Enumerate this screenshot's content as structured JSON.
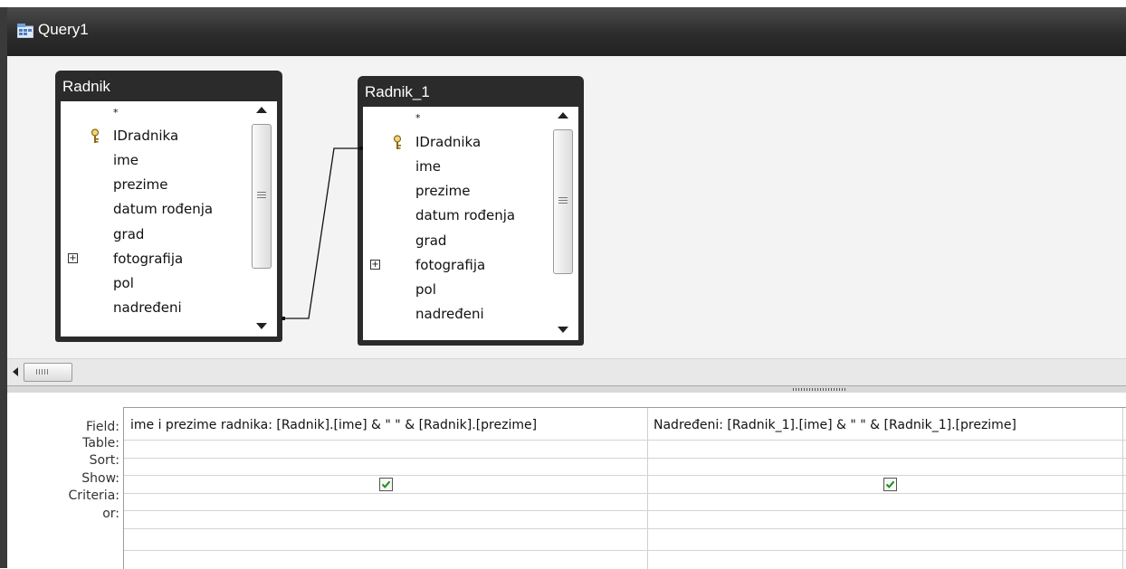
{
  "window": {
    "title": "Query1",
    "icon": "query-icon"
  },
  "tables": [
    {
      "name": "Radnik",
      "fields": [
        {
          "label": "*",
          "key": false,
          "expandable": false
        },
        {
          "label": "IDradnika",
          "key": true,
          "expandable": false
        },
        {
          "label": "ime",
          "key": false,
          "expandable": false
        },
        {
          "label": "prezime",
          "key": false,
          "expandable": false
        },
        {
          "label": "datum rođenja",
          "key": false,
          "expandable": false
        },
        {
          "label": "grad",
          "key": false,
          "expandable": false
        },
        {
          "label": "fotografija",
          "key": false,
          "expandable": true
        },
        {
          "label": "pol",
          "key": false,
          "expandable": false
        },
        {
          "label": "nadređeni",
          "key": false,
          "expandable": false
        }
      ]
    },
    {
      "name": "Radnik_1",
      "fields": [
        {
          "label": "*",
          "key": false,
          "expandable": false
        },
        {
          "label": "IDradnika",
          "key": true,
          "expandable": false
        },
        {
          "label": "ime",
          "key": false,
          "expandable": false
        },
        {
          "label": "prezime",
          "key": false,
          "expandable": false
        },
        {
          "label": "datum rođenja",
          "key": false,
          "expandable": false
        },
        {
          "label": "grad",
          "key": false,
          "expandable": false
        },
        {
          "label": "fotografija",
          "key": false,
          "expandable": true
        },
        {
          "label": "pol",
          "key": false,
          "expandable": false
        },
        {
          "label": "nadređeni",
          "key": false,
          "expandable": false
        }
      ]
    }
  ],
  "join": {
    "from": "Radnik.nadređeni",
    "to": "Radnik_1.IDradnika"
  },
  "grid": {
    "row_labels": [
      "Field:",
      "Table:",
      "Sort:",
      "Show:",
      "Criteria:",
      "or:"
    ],
    "columns": [
      {
        "field": "ime i prezime radnika: [Radnik].[ime] & \" \" & [Radnik].[prezime]",
        "table": "",
        "sort": "",
        "show": true,
        "criteria": "",
        "or": ""
      },
      {
        "field": "Nadređeni: [Radnik_1].[ime] & \" \" & [Radnik_1].[prezime]",
        "table": "",
        "sort": "",
        "show": true,
        "criteria": "",
        "or": ""
      }
    ]
  },
  "colors": {
    "title_bar": "#2c2c2c",
    "design_surface": "#f3f3f3",
    "checkbox_check": "#2e8b2e"
  }
}
